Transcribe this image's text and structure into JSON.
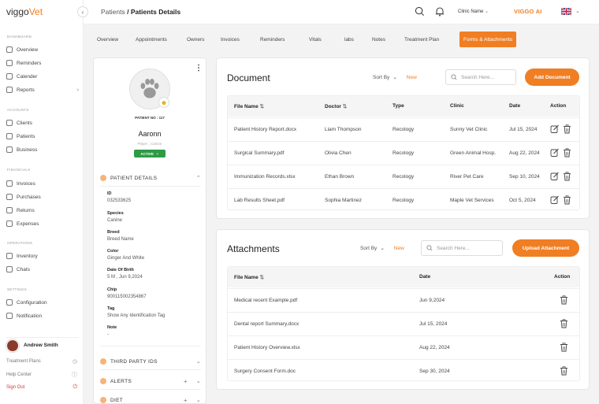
{
  "app": {
    "logo_main": "viggo",
    "logo_accent": "Vet"
  },
  "sidebar": {
    "sections": [
      {
        "label": "Dashboard",
        "items": [
          {
            "label": "Overview"
          },
          {
            "label": "Reminders"
          },
          {
            "label": "Calender"
          },
          {
            "label": "Reports",
            "chevron": "›"
          }
        ]
      },
      {
        "label": "Accounts",
        "items": [
          {
            "label": "Clients"
          },
          {
            "label": "Patients"
          },
          {
            "label": "Business"
          }
        ]
      },
      {
        "label": "Financials",
        "items": [
          {
            "label": "Invoices"
          },
          {
            "label": "Purchases"
          },
          {
            "label": "Returns"
          },
          {
            "label": "Expenses"
          }
        ]
      },
      {
        "label": "Operations",
        "items": [
          {
            "label": "Inventory"
          },
          {
            "label": "Chats"
          }
        ]
      },
      {
        "label": "Settings",
        "items": [
          {
            "label": "Configuration"
          },
          {
            "label": "Notification"
          }
        ]
      }
    ],
    "user": {
      "name": "Andrew Smith"
    },
    "bottom_links": [
      {
        "label": "Treatment Plans"
      },
      {
        "label": "Help Center"
      },
      {
        "label": "Sign Out"
      }
    ]
  },
  "header": {
    "breadcrumb_parent": "Patients",
    "breadcrumb_current": "/ Patients Details",
    "clinic_label": "Clinic Name",
    "ai_label": "VIGGO AI"
  },
  "tabs": [
    {
      "label": "Overview"
    },
    {
      "label": "Appointments"
    },
    {
      "label": "Owners"
    },
    {
      "label": "Invoices"
    },
    {
      "label": "Reminders"
    },
    {
      "label": "Vitals"
    },
    {
      "label": "labs"
    },
    {
      "label": "Notes"
    },
    {
      "label": "Treatment Plan"
    },
    {
      "label": "Forms & Attachments",
      "active": true
    }
  ],
  "patient": {
    "number": "PATIENT NO : 117",
    "name": "Aaronn",
    "species": "Player , Canine",
    "status": "ACTIVE",
    "details_title": "PATIENT DETAILS",
    "fields": [
      {
        "label": "ID",
        "value": "032533625"
      },
      {
        "label": "Species",
        "value": "Canine"
      },
      {
        "label": "Breed",
        "value": "Breed Name"
      },
      {
        "label": "Color",
        "value": "Ginger And White"
      },
      {
        "label": "Date Of Birth",
        "value": "5 M , Jun 9,2024"
      },
      {
        "label": "Chip",
        "value": "900115002354867"
      },
      {
        "label": "Tag",
        "value": "Show Any Identification Tag"
      },
      {
        "label": "Note",
        "value": "-"
      }
    ],
    "third_party_title": "THIRD PARTY IDS",
    "alerts_title": "ALERTS",
    "diet_title": "DIET"
  },
  "documents": {
    "title": "Document",
    "sort_label": "Sort By",
    "sort_value": "New",
    "search_placeholder": "Search Here...",
    "add_button": "Add Document",
    "columns": [
      "File Name",
      "Doctor",
      "Type",
      "Clinic",
      "Date",
      "Action"
    ],
    "rows": [
      {
        "file": "Patient History Report.docx",
        "doctor": "Liam Thompson",
        "type": "Recology",
        "clinic": "Sunny Vet Clinic",
        "date": "Jul 15, 2024"
      },
      {
        "file": "Surgical Summary.pdf",
        "doctor": "Olivia Chen",
        "type": "Recology",
        "clinic": "Green Animal Hosp.",
        "date": "Aug 22, 2024"
      },
      {
        "file": "Immunization Records.xlsx",
        "doctor": "Ethan Brown",
        "type": "Recology",
        "clinic": "River Pet Care",
        "date": "Sep 10, 2024"
      },
      {
        "file": "Lab Results Sheet.pdf",
        "doctor": "Sophia Martinez",
        "type": "Recology",
        "clinic": "Maple Vet Services",
        "date": "Oct 5, 2024"
      }
    ]
  },
  "attachments": {
    "title": "Attachments",
    "sort_label": "Sort By",
    "sort_value": "New",
    "search_placeholder": "Search Here...",
    "upload_button": "Upload Attachment",
    "columns": [
      "File Name",
      "Date",
      "Action"
    ],
    "rows": [
      {
        "file": "Medical recent Example.pdf",
        "date": "Jun 9,2024"
      },
      {
        "file": "Dental report Summary.docx",
        "date": "Jul 15, 2024"
      },
      {
        "file": "Patient History Overview.xlsx",
        "date": "Aug 22, 2024"
      },
      {
        "file": "Surgery Consent Form.doc",
        "date": "Sep 30, 2024"
      }
    ]
  },
  "colors": {
    "accent": "#f07e23",
    "active_badge": "#2e9b46",
    "signout": "#dd3333"
  }
}
